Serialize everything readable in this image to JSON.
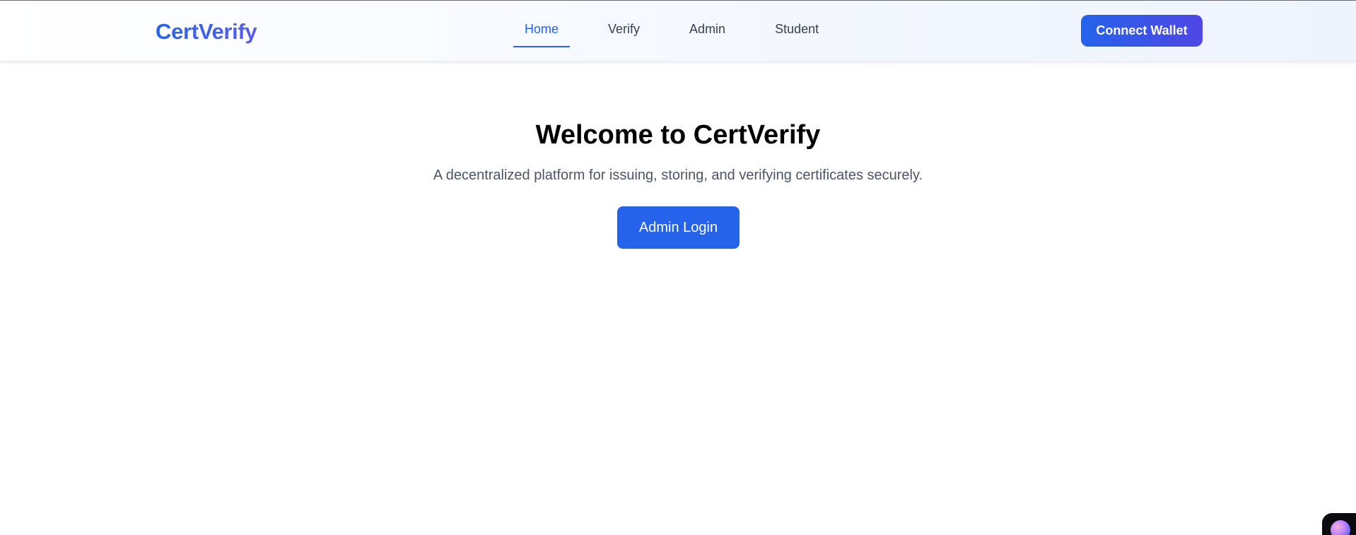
{
  "navbar": {
    "brand": "CertVerify",
    "links": [
      {
        "label": "Home",
        "active": true
      },
      {
        "label": "Verify",
        "active": false
      },
      {
        "label": "Admin",
        "active": false
      },
      {
        "label": "Student",
        "active": false
      }
    ],
    "connect_wallet_label": "Connect Wallet"
  },
  "hero": {
    "title": "Welcome to CertVerify",
    "subtitle": "A decentralized platform for issuing, storing, and verifying certificates securely.",
    "admin_login_label": "Admin Login"
  },
  "corner_widget": {
    "icon": "assistant-orb-icon"
  },
  "colors": {
    "accent": "#2563eb",
    "accent_gradient_end": "#4f46e5",
    "nav_text": "#374151",
    "subtitle_text": "#4b5563",
    "heading_text": "#000000"
  }
}
